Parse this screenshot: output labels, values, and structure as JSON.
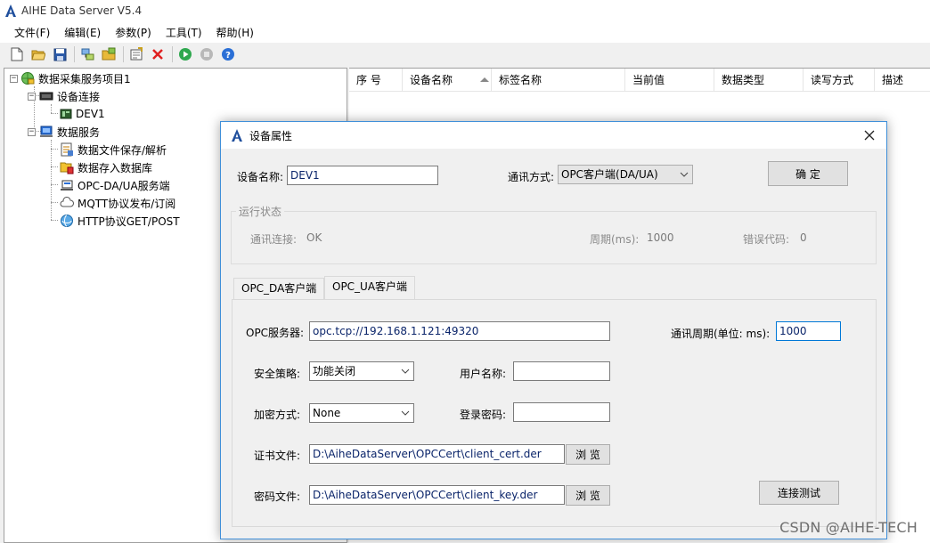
{
  "window": {
    "title": "AIHE Data Server V5.4"
  },
  "menu": [
    "文件(F)",
    "编辑(E)",
    "参数(P)",
    "工具(T)",
    "帮助(H)"
  ],
  "tree": {
    "root": "数据采集服务项目1",
    "device_group": "设备连接",
    "device": "DEV1",
    "service_group": "数据服务",
    "services": [
      "数据文件保存/解析",
      "数据存入数据库",
      "OPC-DA/UA服务端",
      "MQTT协议发布/订阅",
      "HTTP协议GET/POST"
    ]
  },
  "list": {
    "columns": [
      "序 号",
      "设备名称",
      "标签名称",
      "当前值",
      "数据类型",
      "读写方式",
      "描述"
    ]
  },
  "dialog": {
    "title": "设备属性",
    "device_name_label": "设备名称:",
    "device_name_value": "DEV1",
    "comm_mode_label": "通讯方式:",
    "comm_mode_value": "OPC客户端(DA/UA)",
    "ok_button": "确    定",
    "status_group": "运行状态",
    "comm_conn_label": "通讯连接:",
    "comm_conn_value": "OK",
    "period_label": "周期(ms):",
    "period_value": "1000",
    "error_code_label": "错误代码:",
    "error_code_value": "0",
    "tabs": [
      "OPC_DA客户端",
      "OPC_UA客户端"
    ],
    "active_tab": "OPC_UA客户端",
    "opc_server_label": "OPC服务器:",
    "opc_server_value": "opc.tcp://192.168.1.121:49320",
    "comm_period_label": "通讯周期(单位: ms):",
    "comm_period_value": "1000",
    "security_policy_label": "安全策略:",
    "security_policy_value": "功能关闭",
    "username_label": "用户名称:",
    "username_value": "",
    "encryption_label": "加密方式:",
    "encryption_value": "None",
    "password_label": "登录密码:",
    "password_value": "",
    "cert_file_label": "证书文件:",
    "cert_file_value": "D:\\AiheDataServer\\OPCCert\\client_cert.der",
    "browse_label": "浏 览",
    "key_file_label": "密码文件:",
    "key_file_value": "D:\\AiheDataServer\\OPCCert\\client_key.der",
    "connect_test_button": "连接测试"
  },
  "watermark": "CSDN @AIHE-TECH"
}
